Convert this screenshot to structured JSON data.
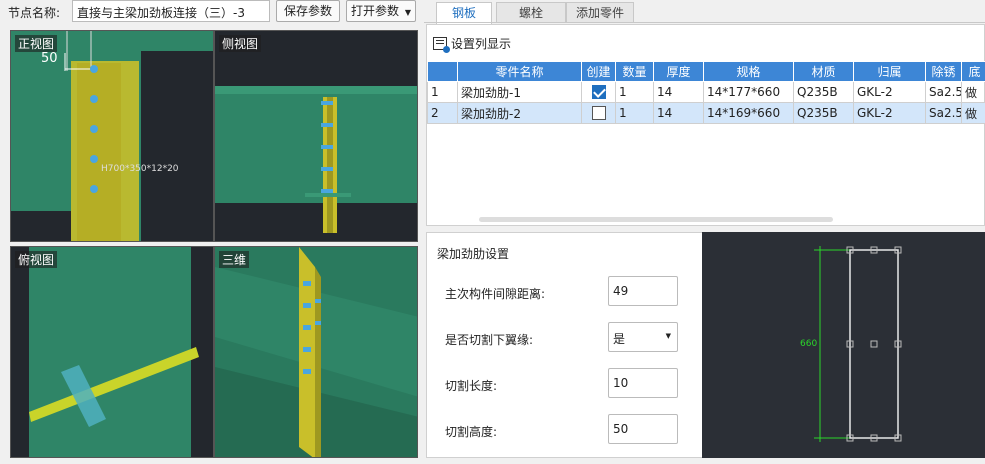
{
  "topbar": {
    "node_label": "节点名称:",
    "node_name": "直接与主梁加劲板连接（三）-3",
    "save_button": "保存参数",
    "open_button": "打开参数"
  },
  "views": {
    "front": {
      "label": "正视图",
      "dim_value": "50",
      "beam_text": "H700*350*12*20"
    },
    "side": {
      "label": "侧视图"
    },
    "top": {
      "label": "俯视图"
    },
    "three_d": {
      "label": "三维"
    }
  },
  "tabs": [
    {
      "label": "钢板",
      "active": true
    },
    {
      "label": "螺栓",
      "active": false
    },
    {
      "label": "添加零件",
      "active": false
    }
  ],
  "toolbar": {
    "column_settings": "设置列显示"
  },
  "table": {
    "headers": [
      "",
      "零件名称",
      "创建",
      "数量",
      "厚度",
      "规格",
      "材质",
      "归属",
      "除锈",
      "底"
    ],
    "rows": [
      {
        "index": "1",
        "name": "梁加劲肋-1",
        "create": true,
        "qty": "1",
        "thickness": "14",
        "spec": "14*177*660",
        "material": "Q235B",
        "owner": "GKL-2",
        "rust": "Sa2.5",
        "extra": "做"
      },
      {
        "index": "2",
        "name": "梁加劲肋-2",
        "create": false,
        "qty": "1",
        "thickness": "14",
        "spec": "14*169*660",
        "material": "Q235B",
        "owner": "GKL-2",
        "rust": "Sa2.5",
        "extra": "做"
      }
    ]
  },
  "settings": {
    "title": "梁加劲肋设置",
    "gap_label": "主次构件间隙距离:",
    "gap_value": "49",
    "cut_flange_label": "是否切割下翼缘:",
    "cut_flange_value": "是",
    "cut_length_label": "切割长度:",
    "cut_length_value": "10",
    "cut_height_label": "切割高度:",
    "cut_height_value": "50"
  },
  "preview": {
    "dim_label": "660"
  },
  "colors": {
    "accent": "#1f6fbf",
    "header_blue": "#3d86d6",
    "model_green": "#2e7d62",
    "plate_yellow": "#c8c02a",
    "dim_green": "#2bd62b"
  }
}
